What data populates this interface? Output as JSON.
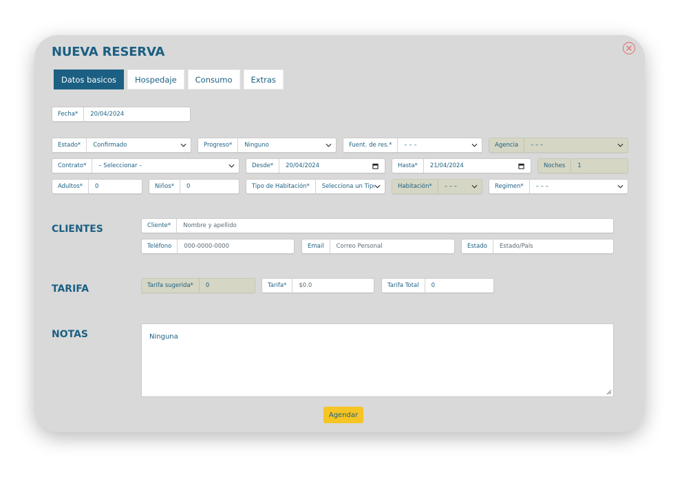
{
  "title": "NUEVA RESERVA",
  "tabs": [
    "Datos basicos",
    "Hospedaje",
    "Consumo",
    "Extras"
  ],
  "fecha": {
    "label": "Fecha*",
    "value": "20/04/2024"
  },
  "estado": {
    "label": "Estado*",
    "value": "Confirmado"
  },
  "progreso": {
    "label": "Progreso*",
    "value": "Ninguno"
  },
  "fuente": {
    "label": "Fuent. de res.*",
    "value": "– – –"
  },
  "agencia": {
    "label": "Agencia",
    "value": "– – –"
  },
  "contrato": {
    "label": "Contrato*",
    "value": "– Seleccionar –"
  },
  "desde": {
    "label": "Desde*",
    "value": "20/04/2024"
  },
  "hasta": {
    "label": "Hasta*",
    "value": "21/04/2024"
  },
  "noches": {
    "label": "Noches",
    "value": "1"
  },
  "adultos": {
    "label": "Adultos*",
    "value": "0"
  },
  "ninos": {
    "label": "Niños*",
    "value": "0"
  },
  "tipo_habitacion": {
    "label": "Tipo de Habitación*",
    "value": "Selecciona un Tipo de"
  },
  "habitacion": {
    "label": "Habitación*",
    "value": "– – –"
  },
  "regimen": {
    "label": "Regimen*",
    "value": "– – –"
  },
  "clientes": {
    "section": "CLIENTES",
    "cliente": {
      "label": "Cliente*",
      "placeholder": "Nombre y apellido"
    },
    "telefono": {
      "label": "Teléfono",
      "placeholder": "000-0000-0000"
    },
    "email": {
      "label": "Email",
      "placeholder": "Correo Personal"
    },
    "estado": {
      "label": "Estado",
      "placeholder": "Estado/País"
    }
  },
  "tarifa": {
    "section": "TARIFA",
    "sugerida": {
      "label": "Tarifa sugerida*",
      "value": "0"
    },
    "tarifa": {
      "label": "Tarifa*",
      "value": "$0.0"
    },
    "total": {
      "label": "Tarifa Total",
      "value": "0"
    }
  },
  "notas": {
    "section": "NOTAS",
    "value": "Ninguna"
  },
  "submit_label": "Agendar",
  "icons": {
    "close": "close-circle-icon",
    "dropdown": "chevron-down-icon",
    "date": "calendar-icon"
  },
  "colors": {
    "primary": "#1b5f82",
    "accent": "#f6c423",
    "readonly": "#d6d6c4",
    "close": "#e46d6d"
  }
}
